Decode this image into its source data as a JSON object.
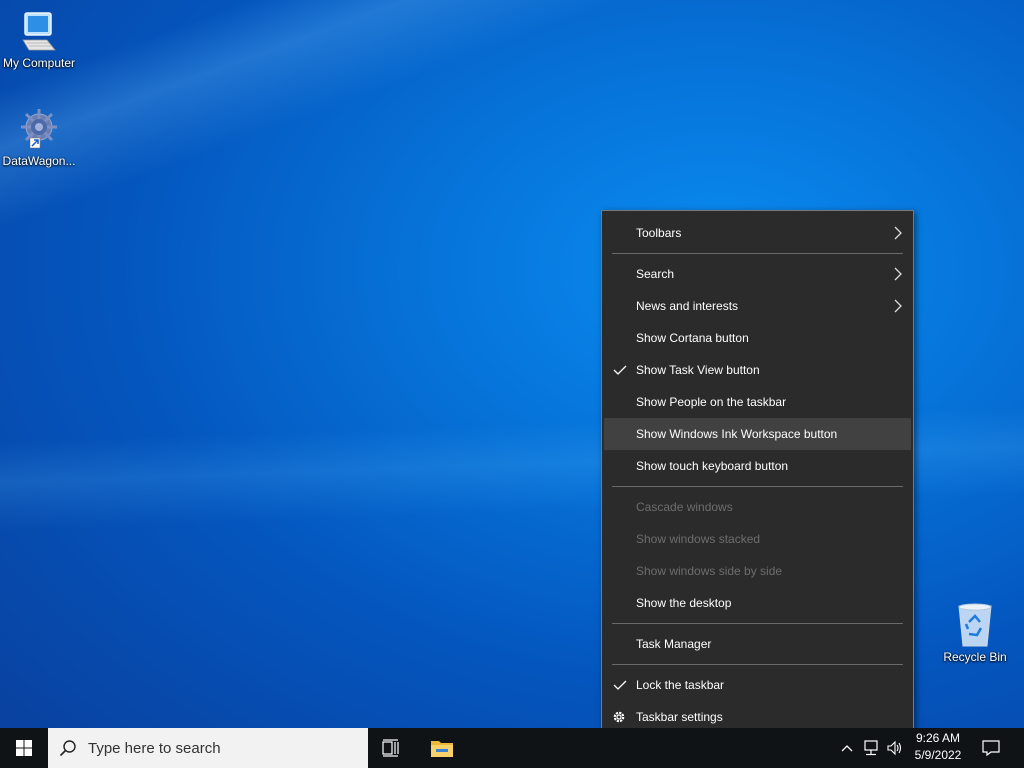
{
  "desktop": {
    "icons": [
      {
        "label": "My Computer"
      },
      {
        "label": "DataWagon..."
      },
      {
        "label": "Recycle Bin"
      }
    ]
  },
  "context_menu": {
    "items": {
      "toolbars": "Toolbars",
      "search": "Search",
      "news": "News and interests",
      "cortana": "Show Cortana button",
      "task_view": "Show Task View button",
      "people": "Show People on the taskbar",
      "ink": "Show Windows Ink Workspace button",
      "touch_keyboard": "Show touch keyboard button",
      "cascade": "Cascade windows",
      "stacked": "Show windows stacked",
      "side_by_side": "Show windows side by side",
      "show_desktop": "Show the desktop",
      "task_manager": "Task Manager",
      "lock": "Lock the taskbar",
      "settings": "Taskbar settings"
    },
    "checked": [
      "task_view",
      "lock"
    ],
    "disabled": [
      "cascade",
      "stacked",
      "side_by_side"
    ],
    "highlighted": "ink"
  },
  "taskbar": {
    "search_placeholder": "Type here to search",
    "clock": {
      "time": "9:26 AM",
      "date": "5/9/2022"
    }
  },
  "colors": {
    "menu_bg": "#2b2b2b",
    "menu_hover": "#414141",
    "taskbar_bg": "#101316",
    "accent_folder": "#f2c94c"
  },
  "icons": [
    "monitor-icon",
    "gear-app-icon",
    "recycle-bin-icon",
    "windows-logo-icon",
    "search-icon",
    "task-view-icon",
    "file-explorer-icon",
    "chevron-up-icon",
    "network-icon",
    "speaker-icon",
    "notification-icon",
    "chevron-right-icon",
    "check-icon",
    "settings-gear-icon"
  ]
}
